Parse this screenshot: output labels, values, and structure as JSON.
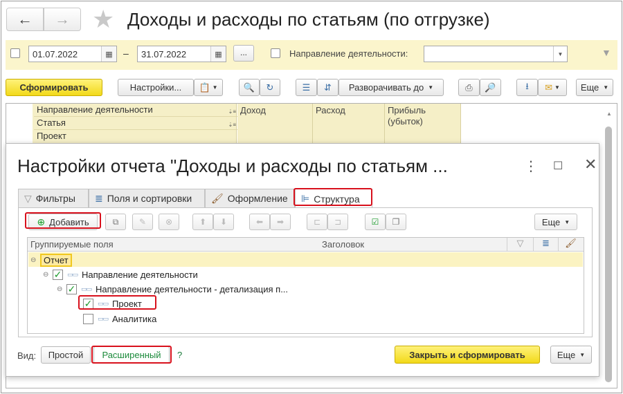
{
  "title": "Доходы и расходы по статьям (по отгрузке)",
  "nav": {
    "back_icon": "←",
    "forward_icon": "→"
  },
  "filters": {
    "date_from": "01.07.2022",
    "dash": "–",
    "date_to": "31.07.2022",
    "period_button": "...",
    "activity_label": "Направление деятельности:",
    "activity_value": ""
  },
  "toolbar": {
    "generate": "Сформировать",
    "settings": "Настройки...",
    "expand_to": "Разворачивать до",
    "more": "Еще"
  },
  "report": {
    "headers": {
      "dimensions": [
        "Направление деятельности",
        "Статья",
        "Проект"
      ],
      "income": "Доход",
      "expense": "Расход",
      "profit": "Прибыль (убыток)"
    }
  },
  "dialog": {
    "title": "Настройки отчета \"Доходы и расходы по статьям ...",
    "tabs": [
      "Фильтры",
      "Поля и сортировки",
      "Оформление",
      "Структура"
    ],
    "add_button": "Добавить",
    "more": "Еще",
    "columns": {
      "fields": "Группируемые поля",
      "heading": "Заголовок"
    },
    "tree": [
      {
        "label": "Отчет",
        "level": 0,
        "checked": null
      },
      {
        "label": "Направление деятельности",
        "level": 1,
        "checked": true
      },
      {
        "label": "Направление деятельности - детализация п...",
        "level": 2,
        "checked": true
      },
      {
        "label": "Проект",
        "level": 3,
        "checked": true
      },
      {
        "label": "Аналитика",
        "level": 3,
        "checked": false
      }
    ],
    "view_label": "Вид:",
    "view_simple": "Простой",
    "view_extended": "Расширенный",
    "help": "?",
    "close_generate": "Закрыть и сформировать",
    "footer_more": "Еще"
  },
  "colors": {
    "accent_yellow": "#f5dc22",
    "highlight_red": "#d8101c",
    "panel_yellow": "#fbf5cc"
  }
}
